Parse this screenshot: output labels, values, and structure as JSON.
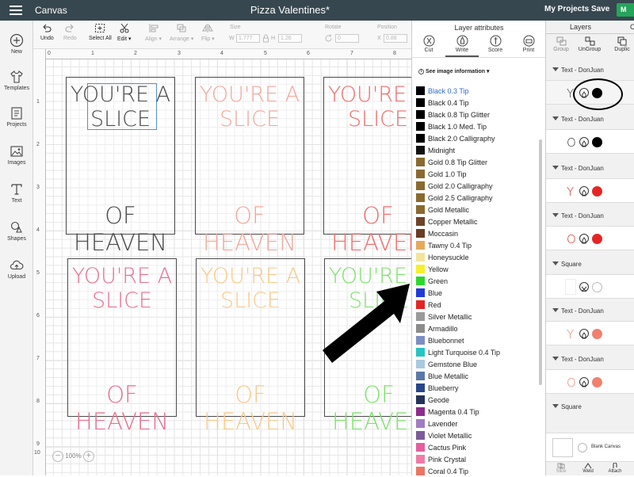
{
  "app": {
    "title": "Canvas",
    "document_title": "Pizza Valentines*",
    "my_projects": "My Projects",
    "save": "Save",
    "make": "M"
  },
  "sidebar": {
    "items": [
      {
        "label": "New",
        "icon": "plus-circle-icon"
      },
      {
        "label": "Templates",
        "icon": "shirt-icon"
      },
      {
        "label": "Projects",
        "icon": "projects-icon"
      },
      {
        "label": "Images",
        "icon": "image-icon"
      },
      {
        "label": "Text",
        "icon": "text-icon"
      },
      {
        "label": "Shapes",
        "icon": "shapes-icon"
      },
      {
        "label": "Upload",
        "icon": "upload-cloud-icon"
      }
    ]
  },
  "toolbar": {
    "undo": "Undo",
    "redo": "Redo",
    "select_all": "Select All",
    "edit": "Edit ▾",
    "align": "Align ▾",
    "arrange": "Arrange ▾",
    "flip": "Flip ▾",
    "size_label": "Size",
    "w_label": "W",
    "w_value": "1.777",
    "h_label": "H",
    "h_value": "1.26",
    "rotate_label": "Rotate",
    "rotate_value": "0",
    "position_label": "Position",
    "x_label": "X",
    "x_value": "0.88",
    "y_label": "Y",
    "y_value": "0.5"
  },
  "rulers": {
    "top": [
      "0",
      "1",
      "2",
      "3",
      "4",
      "5",
      "6",
      "7",
      "8"
    ],
    "left": [
      "1",
      "2",
      "3",
      "4",
      "5",
      "6",
      "7",
      "8",
      "9",
      "10"
    ]
  },
  "cards": [
    {
      "line1": "YOU'RE A",
      "line2": "SLICE",
      "line3": "OF HEAVEN",
      "color": "#4a4a4a",
      "selected": true
    },
    {
      "line1": "YOU'RE A",
      "line2": "SLICE",
      "line3": "OF HEAVEN",
      "color": "#f4a79c"
    },
    {
      "line1": "YOU'RE A",
      "line2": "SLICE",
      "line3": "OF HEAVEN",
      "color": "#f36b6b"
    },
    {
      "line1": "YOU'RE A",
      "line2": "SLICE",
      "line3": "OF HEAVEN",
      "color": "#ea6f8c"
    },
    {
      "line1": "YOU'RE A",
      "line2": "SLICE",
      "line3": "OF HEAVEN",
      "color": "#f9c98a"
    },
    {
      "line1": "YOU'RE A",
      "line2": "SLICE",
      "line3": "OF HEAVEN",
      "color": "#7ce36b"
    }
  ],
  "zoom": {
    "value": "100%",
    "minus": "−",
    "plus": "+"
  },
  "layer_attributes": {
    "title": "Layer attributes",
    "tools": [
      "Cut",
      "Write",
      "Score",
      "Print"
    ],
    "active_tool": "Write",
    "image_info": "See image information ▾",
    "pens": [
      {
        "name": "Black 0.3 Tip",
        "color": "#000000",
        "selected": true
      },
      {
        "name": "Black 0.4 Tip",
        "color": "#000000"
      },
      {
        "name": "Black 0.8 Tip Glitter",
        "color": "#000000"
      },
      {
        "name": "Black 1.0 Med. Tip",
        "color": "#000000"
      },
      {
        "name": "Black 2.0 Calligraphy",
        "color": "#000000"
      },
      {
        "name": "Midnight",
        "color": "#111111"
      },
      {
        "name": "Gold 0.8 Tip Glitter",
        "color": "#8a6a2e"
      },
      {
        "name": "Gold 1.0 Tip",
        "color": "#8a6a2e"
      },
      {
        "name": "Gold 2.0 Calligraphy",
        "color": "#8a6a2e"
      },
      {
        "name": "Gold 2.5 Calligraphy",
        "color": "#8a6a2e"
      },
      {
        "name": "Gold Metallic",
        "color": "#8a6a2e"
      },
      {
        "name": "Copper Metallic",
        "color": "#6e4326"
      },
      {
        "name": "Moccasin",
        "color": "#6b3c23"
      },
      {
        "name": "Tawny 0.4 Tip",
        "color": "#e5a95c"
      },
      {
        "name": "Honeysuckle",
        "color": "#f3e49a"
      },
      {
        "name": "Yellow",
        "color": "#f7f02b"
      },
      {
        "name": "Green",
        "color": "#2bd92b"
      },
      {
        "name": "Blue",
        "color": "#1f3bd8"
      },
      {
        "name": "Red",
        "color": "#e52525"
      },
      {
        "name": "Silver Metallic",
        "color": "#9a9a9a"
      },
      {
        "name": "Armadillo",
        "color": "#8c8c8c"
      },
      {
        "name": "Bluebonnet",
        "color": "#7d8ec4"
      },
      {
        "name": "Light Turquoise 0.4 Tip",
        "color": "#23c5c5"
      },
      {
        "name": "Gemstone Blue",
        "color": "#a9c9de"
      },
      {
        "name": "Blue Metallic",
        "color": "#5a78a6"
      },
      {
        "name": "Blueberry",
        "color": "#29468a"
      },
      {
        "name": "Geode",
        "color": "#243358"
      },
      {
        "name": "Magenta 0.4 Tip",
        "color": "#8e2b8e"
      },
      {
        "name": "Lavender",
        "color": "#a27cc0"
      },
      {
        "name": "Violet Metallic",
        "color": "#7b5b9a"
      },
      {
        "name": "Cactus Pink",
        "color": "#e45ea0"
      },
      {
        "name": "Pink Crystal",
        "color": "#f07ca6"
      },
      {
        "name": "Coral 0.4 Tip",
        "color": "#ec7566"
      }
    ]
  },
  "layers_panel": {
    "tabs": [
      "Layers",
      "C"
    ],
    "tools": [
      "Group",
      "UnGroup",
      "Duplic"
    ],
    "groups": [
      {
        "label": "Text - DonJuan",
        "letter": "Y",
        "letter_color": "#444444",
        "dot_color": "#000000"
      },
      {
        "label": "Text - DonJuan",
        "letter": "O",
        "letter_color": "#333333",
        "dot_color": "#000000"
      },
      {
        "label": "Text - DonJuan",
        "letter": "Y",
        "letter_color": "#e52525",
        "dot_color": "#e52525"
      },
      {
        "label": "Text - DonJuan",
        "letter": "O",
        "letter_color": "#e52525",
        "dot_color": "#e52525"
      },
      {
        "label": "Square",
        "letter": "",
        "letter_color": "#ffffff",
        "dot_color": "#ffffff"
      },
      {
        "label": "Text - DonJuan",
        "letter": "Y",
        "letter_color": "#f08070",
        "dot_color": "#f08070"
      },
      {
        "label": "Text - DonJuan",
        "letter": "O",
        "letter_color": "#f08070",
        "dot_color": "#f08070"
      },
      {
        "label": "Square",
        "letter": "",
        "letter_color": "#ffffff",
        "dot_color": "#ffffff"
      }
    ],
    "blank_canvas": "Blank Canvas",
    "footer": [
      "Slice",
      "Weld",
      "Attach"
    ]
  }
}
